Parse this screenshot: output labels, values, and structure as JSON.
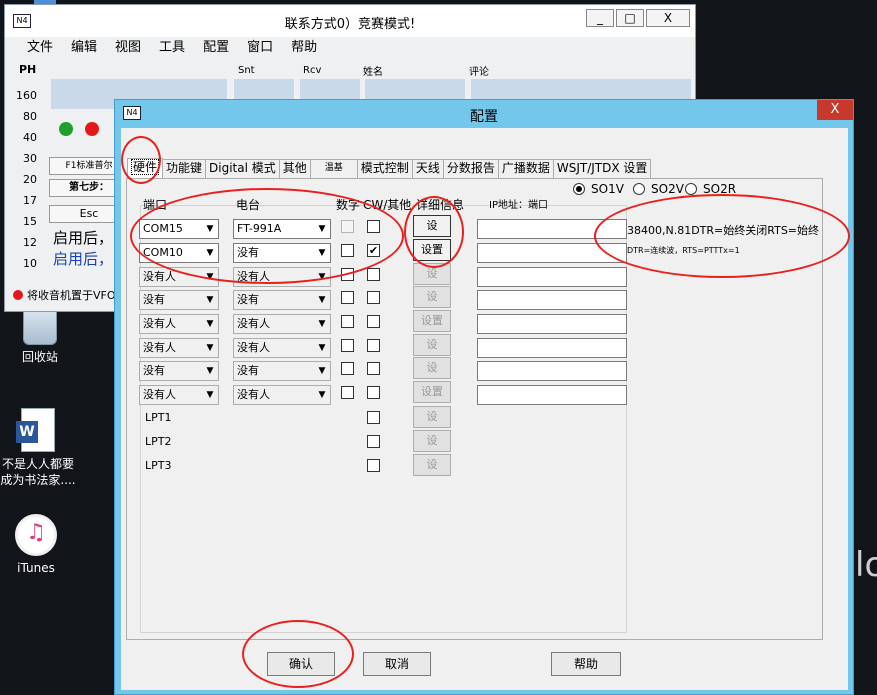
{
  "background_window": {
    "title": "联系方式0）竞赛模式!",
    "logo": "N4",
    "caption_buttons": [
      "_",
      "□",
      "X"
    ],
    "menu": [
      "文件",
      "编辑",
      "视图",
      "工具",
      "配置",
      "窗口",
      "帮助"
    ],
    "ph_label": "PH",
    "bands": [
      "160",
      "80",
      "40",
      "30",
      "20",
      "17",
      "15",
      "12",
      "10"
    ],
    "column_headers": {
      "snt": "Snt",
      "rcv": "Rcv",
      "name": "姓名",
      "comment": "评论"
    },
    "buttons": {
      "f1": "F1标准普尔",
      "step7": "第七步：",
      "esc": "Esc"
    },
    "text_lines": [
      "启用后，",
      "启用后，"
    ],
    "status": "将收音机置于VFO",
    "status_color": "#e51818"
  },
  "desktop": {
    "icons": [
      {
        "label": "回收站",
        "icon": "recycle-bin-icon"
      },
      {
        "label": "不是人人都要成为书法家....",
        "icon": "word-document-icon"
      },
      {
        "label": "iTunes",
        "icon": "itunes-icon"
      }
    ],
    "edge_glyph": "lo"
  },
  "dialog": {
    "title": "配置",
    "logo": "N4",
    "close": "X",
    "tabs": [
      "硬件",
      "功能键",
      "Digital 模式",
      "其他",
      "温基",
      "模式控制",
      "天线",
      "分数报告",
      "广播数据",
      "WSJT/JTDX 设置"
    ],
    "active_tab": "硬件",
    "radios": [
      {
        "label": "SO1V",
        "selected": true
      },
      {
        "label": "SO2V",
        "selected": false
      },
      {
        "label": "SO2R",
        "selected": false
      }
    ],
    "column_headers": {
      "port": "端口",
      "radio": "电台",
      "digital": "数字",
      "cw_other": "CW/其他",
      "detail": "详细信息",
      "ip": "IP地址：端口"
    },
    "rows": [
      {
        "port": "COM15",
        "radio": "FT-991A",
        "enabled": true,
        "digital": false,
        "cw": false,
        "set": "设",
        "set_enabled": true
      },
      {
        "port": "COM10",
        "radio": "没有",
        "enabled": true,
        "digital": false,
        "cw": true,
        "set": "设置",
        "set_enabled": true
      },
      {
        "port": "没有人",
        "radio": "没有人",
        "enabled": false,
        "digital": false,
        "cw": false,
        "set": "设",
        "set_enabled": false
      },
      {
        "port": "没有",
        "radio": "没有",
        "enabled": false,
        "digital": false,
        "cw": false,
        "set": "设",
        "set_enabled": false
      },
      {
        "port": "没有人",
        "radio": "没有人",
        "enabled": false,
        "digital": false,
        "cw": false,
        "set": "设置",
        "set_enabled": false
      },
      {
        "port": "没有人",
        "radio": "没有人",
        "enabled": false,
        "digital": false,
        "cw": false,
        "set": "设",
        "set_enabled": false
      },
      {
        "port": "没有",
        "radio": "没有",
        "enabled": false,
        "digital": false,
        "cw": false,
        "set": "设",
        "set_enabled": false
      },
      {
        "port": "没有人",
        "radio": "没有人",
        "enabled": false,
        "digital": false,
        "cw": false,
        "set": "设置",
        "set_enabled": false
      }
    ],
    "lpt_rows": [
      {
        "label": "LPT1",
        "set": "设"
      },
      {
        "label": "LPT2",
        "set": "设"
      },
      {
        "label": "LPT3",
        "set": "设"
      }
    ],
    "port_info_1": "38400,N.81DTR=始终关闭RTS=始终",
    "port_info_2": "DTR=连续波，RTS=PTTTx=1",
    "buttons": {
      "ok": "确认",
      "cancel": "取消",
      "help": "帮助"
    }
  }
}
